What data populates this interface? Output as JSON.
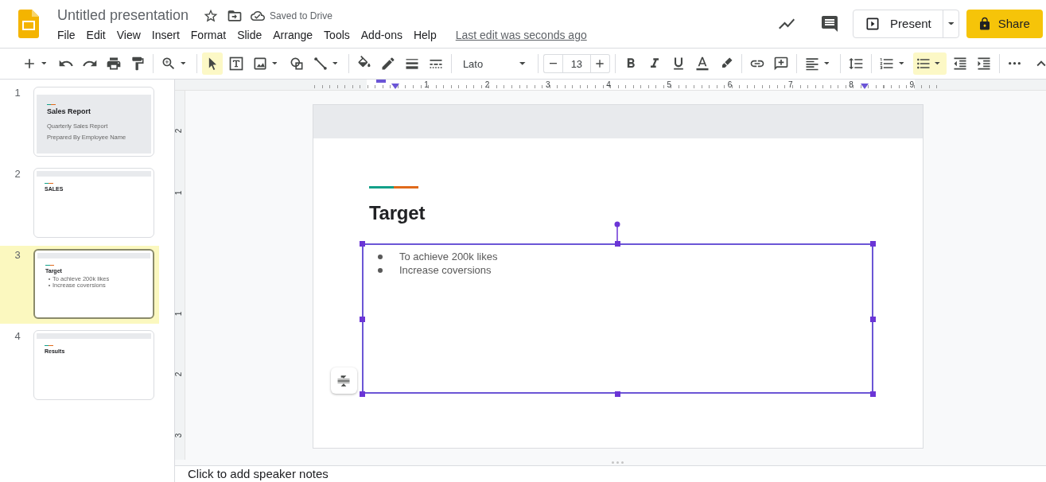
{
  "header": {
    "title": "Untitled presentation",
    "save_status": "Saved to Drive",
    "menu": [
      "File",
      "Edit",
      "View",
      "Insert",
      "Format",
      "Slide",
      "Arrange",
      "Tools",
      "Add-ons",
      "Help"
    ],
    "last_edit": "Last edit was seconds ago",
    "present": "Present",
    "share": "Share"
  },
  "toolbar": {
    "groups": [
      [
        {
          "kind": "add",
          "caret": true,
          "selected": false
        },
        {
          "kind": "undo",
          "caret": false,
          "selected": false
        },
        {
          "kind": "redo",
          "caret": false,
          "selected": false
        },
        {
          "kind": "print",
          "caret": false,
          "selected": false
        },
        {
          "kind": "paint",
          "caret": false,
          "selected": false
        }
      ],
      [
        {
          "kind": "zoom",
          "caret": true,
          "selected": false
        }
      ],
      [
        {
          "kind": "select",
          "caret": false,
          "selected": true
        },
        {
          "kind": "textbox",
          "caret": false,
          "selected": false
        },
        {
          "kind": "image",
          "caret": true,
          "selected": false
        },
        {
          "kind": "shape",
          "caret": false,
          "selected": false
        },
        {
          "kind": "line",
          "caret": true,
          "selected": false
        }
      ],
      [
        {
          "kind": "fill",
          "caret": false,
          "selected": false
        },
        {
          "kind": "pencil",
          "caret": false,
          "selected": false
        },
        {
          "kind": "weight",
          "caret": false,
          "selected": false
        },
        {
          "kind": "dash",
          "caret": false,
          "selected": false
        }
      ],
      [
        {
          "kind": "font",
          "text": "Lato"
        }
      ],
      [
        {
          "kind": "size",
          "text": "13"
        }
      ],
      [
        {
          "kind": "bold",
          "caret": false,
          "selected": false
        },
        {
          "kind": "italic",
          "caret": false,
          "selected": false
        },
        {
          "kind": "underline",
          "caret": false,
          "selected": false
        },
        {
          "kind": "textcolor",
          "caret": false,
          "selected": false
        },
        {
          "kind": "highlight",
          "caret": false,
          "selected": false
        }
      ],
      [
        {
          "kind": "link",
          "caret": false,
          "selected": false
        },
        {
          "kind": "comment",
          "caret": false,
          "selected": false
        }
      ],
      [
        {
          "kind": "align",
          "caret": true,
          "selected": false
        }
      ],
      [
        {
          "kind": "spacing",
          "caret": false,
          "selected": false
        }
      ],
      [
        {
          "kind": "numbered",
          "caret": true,
          "selected": false
        },
        {
          "kind": "bulleted",
          "caret": true,
          "selected": true
        },
        {
          "kind": "outdent",
          "caret": false,
          "selected": false
        },
        {
          "kind": "indent",
          "caret": false,
          "selected": false
        }
      ],
      [
        {
          "kind": "more",
          "caret": false,
          "selected": false
        }
      ]
    ]
  },
  "slides": [
    {
      "number": "1",
      "kind": "title",
      "selected": false,
      "title": "Sales Report",
      "lines": [
        "Quarterly Sales Report",
        "Prepared By Employee Name"
      ]
    },
    {
      "number": "2",
      "kind": "content",
      "selected": false,
      "title": "SALES"
    },
    {
      "number": "3",
      "kind": "content",
      "selected": true,
      "title": "Target",
      "lines": [
        "To achieve 200k likes",
        "Increase coversions"
      ]
    },
    {
      "number": "4",
      "kind": "content",
      "selected": false,
      "title": "Results"
    }
  ],
  "ruler": {
    "horizontal": [
      "1",
      "2",
      "3",
      "4",
      "5",
      "6",
      "7",
      "8",
      "9"
    ],
    "vertical": [
      "2",
      "1",
      "1",
      "2",
      "3"
    ]
  },
  "slide": {
    "title": "Target",
    "bullets": [
      "To achieve 200k likes",
      "Increase coversions"
    ]
  },
  "notes": {
    "placeholder": "Click to add speaker notes"
  }
}
